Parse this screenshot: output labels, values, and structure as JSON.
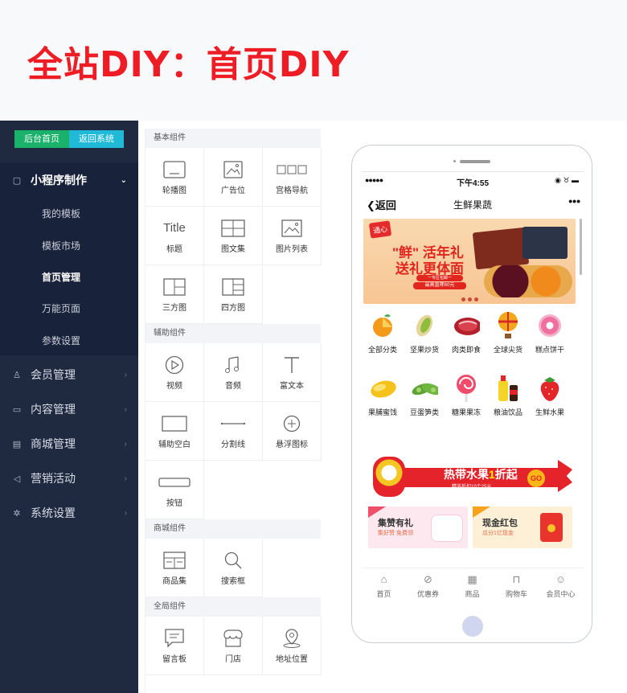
{
  "banner": {
    "title": "全站DIY：首页DIY"
  },
  "sidebar": {
    "btn_home": "后台首页",
    "btn_return": "返回系统",
    "groups": [
      {
        "label": "小程序制作",
        "icon": "square-icon"
      },
      {
        "label": "会员管理",
        "icon": "user-icon"
      },
      {
        "label": "内容管理",
        "icon": "monitor-icon"
      },
      {
        "label": "商城管理",
        "icon": "cart-icon"
      },
      {
        "label": "营销活动",
        "icon": "megaphone-icon"
      },
      {
        "label": "系统设置",
        "icon": "gear-icon"
      }
    ],
    "sub_items": [
      "我的模板",
      "模板市场",
      "首页管理",
      "万能页面",
      "参数设置"
    ],
    "active_sub": "首页管理"
  },
  "panel": {
    "sections": [
      "基本组件",
      "辅助组件",
      "商城组件",
      "全局组件"
    ],
    "basic": [
      "轮播图",
      "广告位",
      "宫格导航",
      "标题",
      "图文集",
      "图片列表",
      "三方图",
      "四方图"
    ],
    "title_text": "Title",
    "aux": [
      "视频",
      "音频",
      "富文本",
      "辅助空白",
      "分割线",
      "悬浮图标",
      "按钮"
    ],
    "mall": [
      "商品集",
      "搜索框"
    ],
    "global": [
      "留言板",
      "门店",
      "地址位置"
    ]
  },
  "phone": {
    "status": {
      "signal": "●●●●●",
      "time": "下午4:55",
      "battery": "◉ ♉ ▬"
    },
    "nav": {
      "back": "❮返回",
      "title": "生鲜果蔬",
      "more": "•••"
    },
    "hero": {
      "logo": "通心",
      "line1": "\"鲜\" 活年礼",
      "line2": "送礼更体面",
      "pill1": "一专区包邮一",
      "pill2": "最高直降60元"
    },
    "cats_row1": [
      "全部分类",
      "坚果炒货",
      "肉类即食",
      "全球尖货",
      "糕点饼干"
    ],
    "cats_row2": [
      "果脯蜜饯",
      "豆蛋笋类",
      "糖果果冻",
      "粮油饮品",
      "生鲜水果"
    ],
    "promo": {
      "text_a": "热带水果",
      "text_one": "1",
      "text_b": "折起",
      "sub": "精选折扣10个25元",
      "go": "GO"
    },
    "card1": {
      "title": "集赞有礼",
      "sub": "集好赞 免费领",
      "badge": "NEW"
    },
    "card2": {
      "title": "现金红包",
      "sub": "瓜分1亿现金",
      "badge": "HOT"
    },
    "tabs": [
      {
        "label": "首页",
        "icon": "⌂"
      },
      {
        "label": "优惠券",
        "icon": "⊘"
      },
      {
        "label": "商品",
        "icon": "▦"
      },
      {
        "label": "购物车",
        "icon": "⊓"
      },
      {
        "label": "会员中心",
        "icon": "☺"
      }
    ]
  }
}
